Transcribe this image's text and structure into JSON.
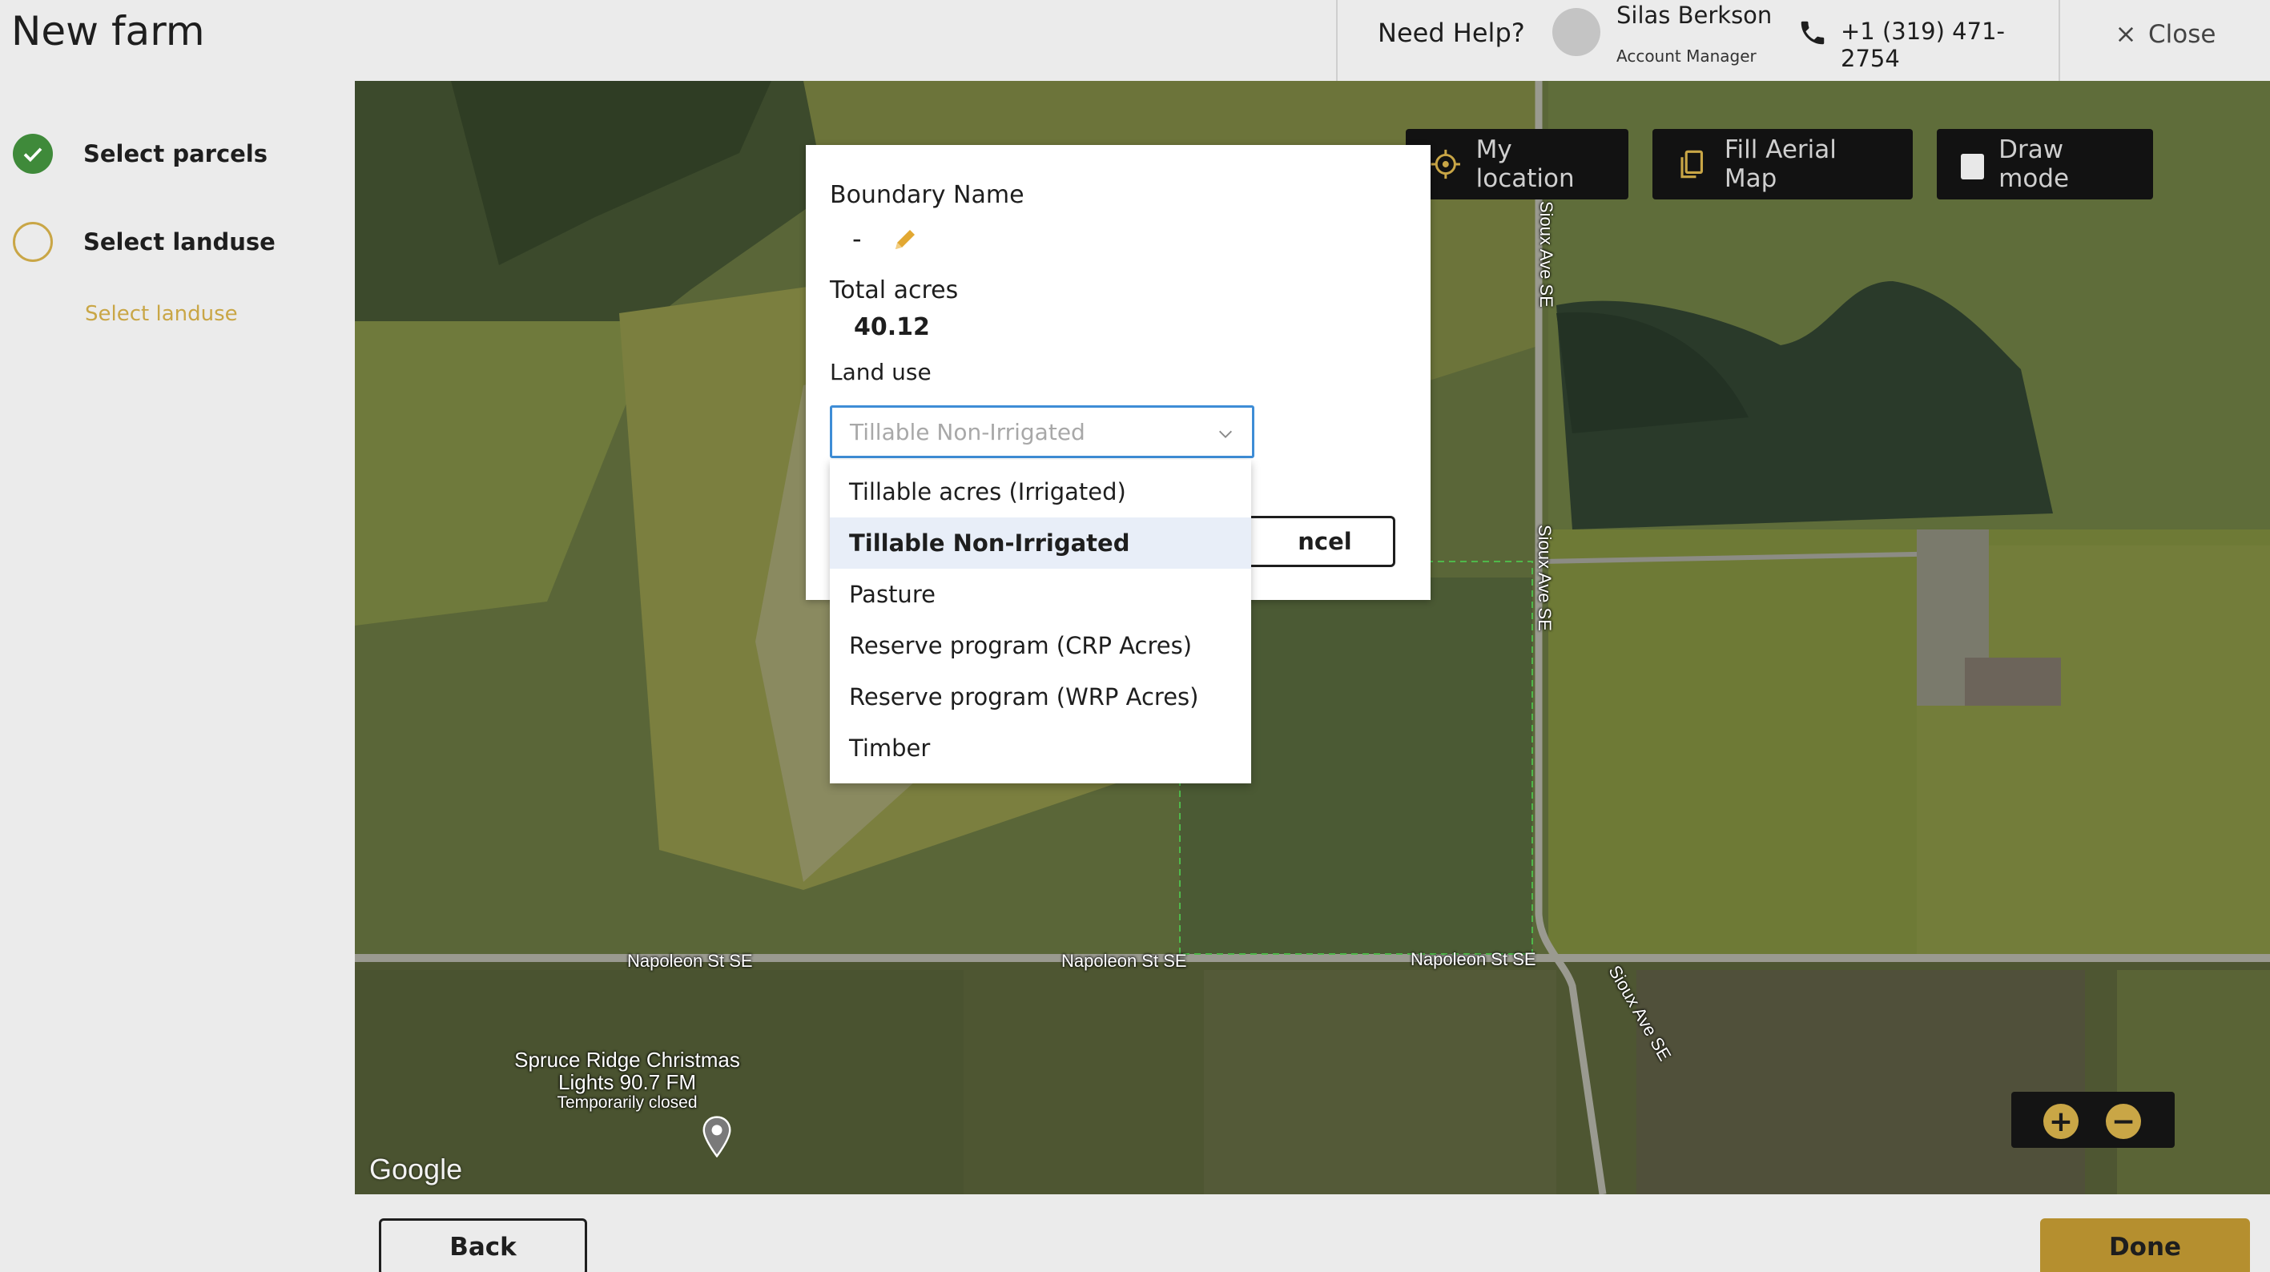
{
  "header": {
    "title": "New farm",
    "help_label": "Need Help?",
    "manager_name": "Silas Berkson",
    "manager_role": "Account Manager",
    "phone": "+1 (319) 471-2754",
    "close_label": "Close",
    "icons": {
      "phone": "phone-icon",
      "close": "close-icon"
    }
  },
  "sidebar": {
    "steps": [
      {
        "label": "Select parcels",
        "status": "completed"
      },
      {
        "label": "Select landuse",
        "status": "current"
      }
    ],
    "substep_label": "Select landuse"
  },
  "map": {
    "buttons": {
      "my_location": "My location",
      "fill_aerial": "Fill Aerial Map",
      "draw_mode": "Draw mode"
    },
    "roads": {
      "napoleon": "Napoleon St SE",
      "sioux": "Sioux Ave SE"
    },
    "poi": {
      "name_line1": "Spruce Ridge Christmas",
      "name_line2": "Lights 90.7 FM",
      "status": "Temporarily closed"
    },
    "attribution": "Google",
    "zoom": {
      "in": "+",
      "out": "−"
    }
  },
  "modal": {
    "boundary_label": "Boundary Name",
    "boundary_value": "-",
    "acres_label": "Total acres",
    "acres_value": "40.12",
    "landuse_label": "Land use",
    "landuse_selected": "Tillable Non-Irrigated",
    "cancel_label": "ncel",
    "options": [
      "Tillable acres (Irrigated)",
      "Tillable Non-Irrigated",
      "Pasture",
      "Reserve program (CRP Acres)",
      "Reserve program (WRP Acres)",
      "Timber"
    ]
  },
  "footer": {
    "back_label": "Back",
    "done_label": "Done"
  },
  "colors": {
    "accent": "#c9a646",
    "done_button": "#b58f2f",
    "success": "#3f8a3a",
    "focus_border": "#3e8dd6",
    "selected_option_bg": "#e8eef8"
  }
}
